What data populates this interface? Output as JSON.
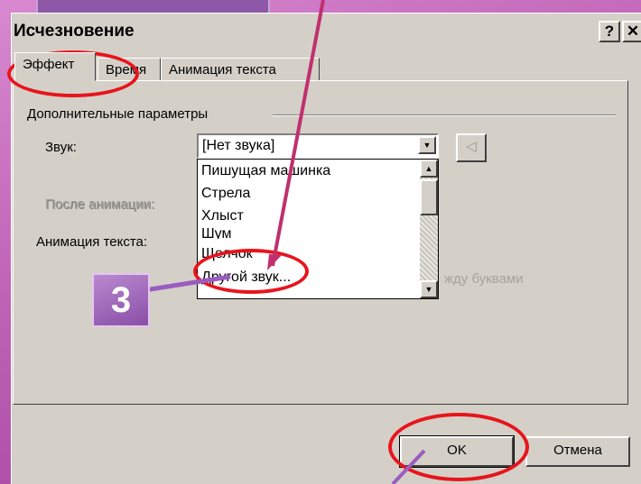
{
  "dialog": {
    "title": "Исчезновение",
    "help_label": "?",
    "close_label": "✕",
    "tabs": [
      {
        "label": "Эффект"
      },
      {
        "label": "Время"
      },
      {
        "label": "Анимация текста"
      }
    ],
    "group_label": "Дополнительные параметры",
    "sound_label": "Звук:",
    "after_anim_label": "После анимации:",
    "text_anim_label": "Анимация текста:",
    "sound_combo_value": "[Нет звука]",
    "sound_options": [
      "Пишущая машинка",
      "Стрела",
      "Хлыст",
      "Шум",
      "Щелчок",
      "Другой звук..."
    ],
    "letters_text": "жду буквами",
    "ok_label": "OK",
    "cancel_label": "Отмена"
  },
  "annotation": {
    "step_number": "3",
    "colors": {
      "ellipse": "#e8141c",
      "arrow": "#c0306e"
    }
  }
}
